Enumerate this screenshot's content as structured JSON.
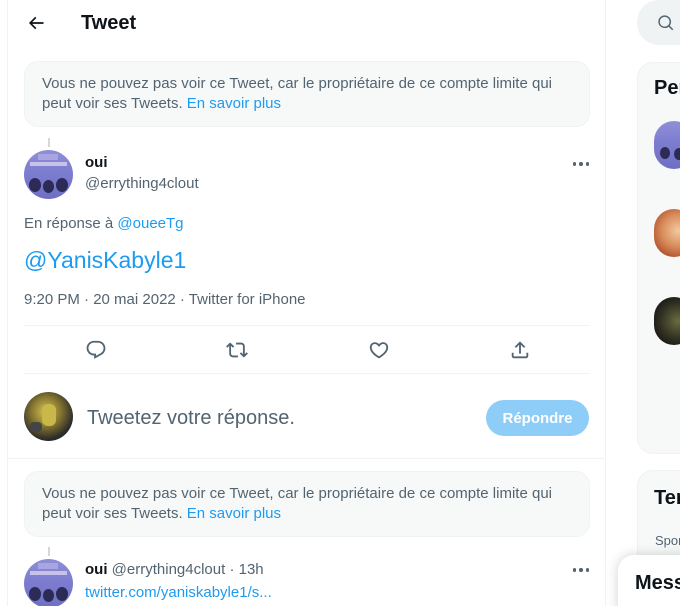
{
  "header": {
    "title": "Tweet"
  },
  "notice": {
    "text": "Vous ne pouvez pas voir ce Tweet, car le propriétaire de ce compte limite qui peut voir ses Tweets.",
    "link": "En savoir plus"
  },
  "notice2": {
    "text": "Vous ne pouvez pas voir ce Tweet, car le propriétaire de ce compte limite qui peut voir ses Tweets.",
    "link": "En savoir plus"
  },
  "tweet": {
    "name": "oui",
    "handle": "@errything4clout",
    "reply_prefix": "En réponse à",
    "reply_to": "@oueeTg",
    "text": "@YanisKabyle1",
    "meta": "9:20 PM · 20 mai 2022 · Twitter for iPhone"
  },
  "actions": {
    "reply_icon": "reply-icon",
    "retweet_icon": "retweet-icon",
    "like_icon": "like-icon",
    "share_icon": "share-icon"
  },
  "composer": {
    "placeholder": "Tweetez votre réponse.",
    "button": "Répondre"
  },
  "bottom_tweet": {
    "name": "oui",
    "handle_time": "@errything4clout · 13h",
    "link": "twitter.com/yaniskabyle1/s..."
  },
  "sidebar": {
    "card1_title": "Per",
    "card2_title": "Ten",
    "card2_sponsor": "Spon",
    "messages": "Mess"
  },
  "colors": {
    "accent": "#1d9bf0",
    "button_disabled": "#8ecdf8",
    "muted": "#536471"
  }
}
